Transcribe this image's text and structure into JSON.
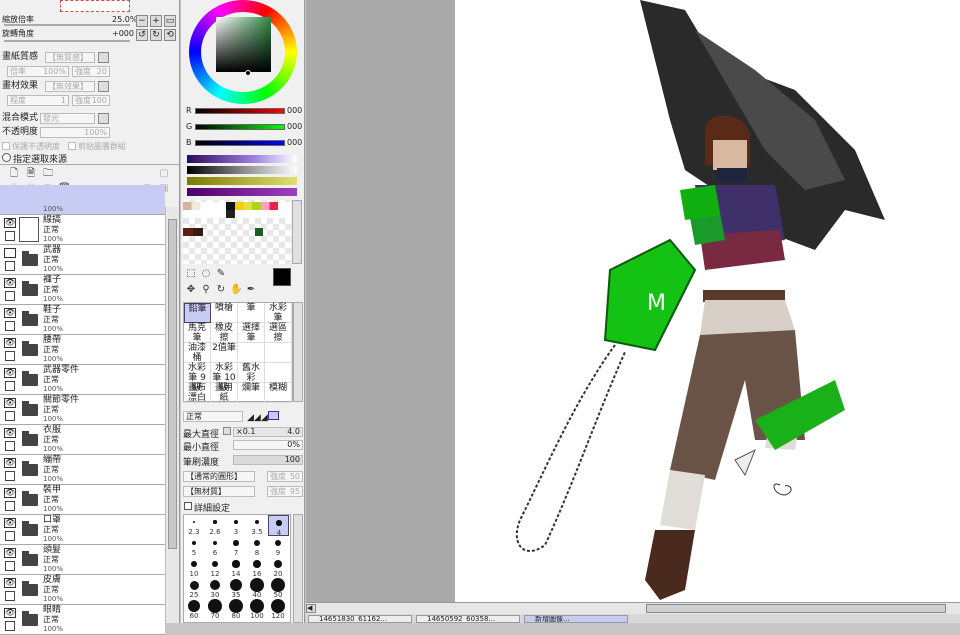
{
  "navigator": {
    "zoom_label": "縮放倍率",
    "zoom_value": "25.0%",
    "rotation_label": "旋轉角度",
    "rotation_value": "+000"
  },
  "paper": {
    "texture_label": "畫紙質感",
    "texture_value": "【無質感】",
    "scale": "倍率",
    "scale_val": "100%",
    "strength": "強度",
    "strength_val": "20",
    "effect_label": "畫材效果",
    "effect_value": "【無效果】",
    "degree": "程度",
    "degree_val": "1",
    "strength2": "強度",
    "strength2_val": "100",
    "blend_label": "混合模式",
    "blend_value": "發光",
    "opacity_label": "不透明度",
    "opacity_value": "100%",
    "protect_opacity": "保護不透明度",
    "clip_group": "剪貼圖層群組",
    "selection_source": "指定選取來源"
  },
  "layers": [
    {
      "name": "",
      "mode": "",
      "pct": "100%"
    },
    {
      "name": "線搞",
      "mode": "正常",
      "pct": "100%",
      "type": "layer",
      "visible": true
    },
    {
      "name": "武器",
      "mode": "正常",
      "pct": "100%",
      "type": "folder",
      "visible": false
    },
    {
      "name": "褲子",
      "mode": "正常",
      "pct": "100%",
      "type": "folder",
      "visible": true
    },
    {
      "name": "鞋子",
      "mode": "正常",
      "pct": "100%",
      "type": "folder",
      "visible": true
    },
    {
      "name": "腰帶",
      "mode": "正常",
      "pct": "100%",
      "type": "folder",
      "visible": true
    },
    {
      "name": "武器零件",
      "mode": "正常",
      "pct": "100%",
      "type": "folder",
      "visible": true
    },
    {
      "name": "關節零件",
      "mode": "正常",
      "pct": "100%",
      "type": "folder",
      "visible": true
    },
    {
      "name": "衣服",
      "mode": "正常",
      "pct": "100%",
      "type": "folder",
      "visible": true
    },
    {
      "name": "繃帶",
      "mode": "正常",
      "pct": "100%",
      "type": "folder",
      "visible": true
    },
    {
      "name": "裝甲",
      "mode": "正常",
      "pct": "100%",
      "type": "folder",
      "visible": true
    },
    {
      "name": "口罩",
      "mode": "正常",
      "pct": "100%",
      "type": "folder",
      "visible": true
    },
    {
      "name": "頭髮",
      "mode": "正常",
      "pct": "100%",
      "type": "folder",
      "visible": true
    },
    {
      "name": "皮膚",
      "mode": "正常",
      "pct": "100%",
      "type": "folder",
      "visible": true
    },
    {
      "name": "眼睛",
      "mode": "正常",
      "pct": "100%",
      "type": "folder",
      "visible": true
    }
  ],
  "color": {
    "r_label": "R",
    "r_val": "000",
    "g_label": "G",
    "g_val": "000",
    "b_label": "B",
    "b_val": "000"
  },
  "brushes": [
    [
      "鉛筆",
      "噴槍",
      "筆",
      "水彩筆"
    ],
    [
      "馬克筆",
      "橡皮擦",
      "選擇筆",
      "選區擦"
    ],
    [
      "油漆桶",
      "2值筆",
      "",
      ""
    ],
    [
      "水彩筆 9級",
      "水彩筆 10級",
      "舊水彩",
      ""
    ],
    [
      "畫布 漂白",
      "畫用紙",
      "爛筆",
      "模糊"
    ]
  ],
  "brush_settings": {
    "mode": "正常",
    "max_size_label": "最大直徑",
    "max_size_mult": "×0.1",
    "max_size_val": "4.0",
    "min_size_label": "最小直徑",
    "min_size_val": "0%",
    "density_label": "筆刷濃度",
    "density_val": "100",
    "shape": "【通常的圓形】",
    "shape_strength": "強度",
    "shape_strength_val": "50",
    "texture": "【無材質】",
    "texture_strength": "強度",
    "texture_strength_val": "95",
    "detail": "詳細設定"
  },
  "dot_sizes": [
    [
      "2.3",
      "2.6",
      "3",
      "3.5",
      "4"
    ],
    [
      "5",
      "6",
      "7",
      "8",
      "9"
    ],
    [
      "10",
      "12",
      "14",
      "16",
      "20"
    ],
    [
      "25",
      "30",
      "35",
      "40",
      "50"
    ],
    [
      "60",
      "70",
      "80",
      "100",
      "120"
    ]
  ],
  "taskbar": [
    "14651830_61162...",
    "14650592_60358...",
    "新增圖像..."
  ],
  "accent": "#c7ccf5"
}
